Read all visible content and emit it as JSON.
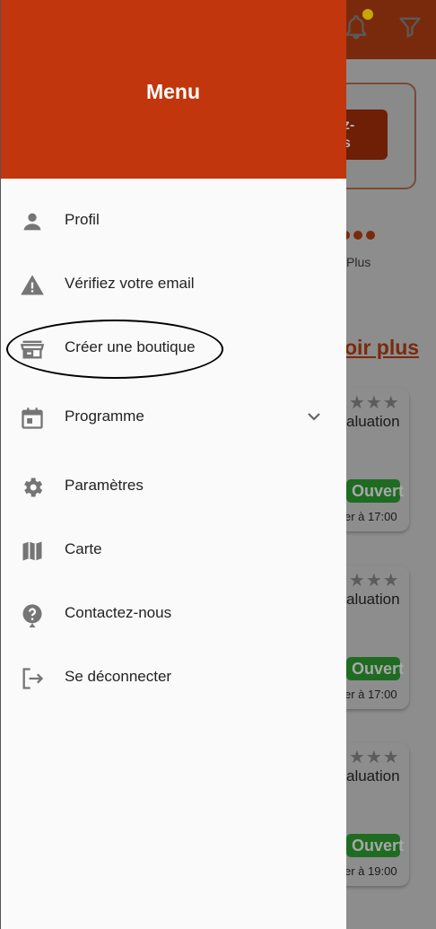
{
  "drawer": {
    "title": "Menu",
    "items": [
      {
        "label": "Profil",
        "icon": "person-icon"
      },
      {
        "label": "Vérifiez votre email",
        "icon": "warning-icon"
      },
      {
        "label": "Créer une boutique",
        "icon": "store-icon"
      },
      {
        "label": "Programme",
        "icon": "calendar-icon"
      },
      {
        "label": "Paramètres",
        "icon": "gear-icon"
      },
      {
        "label": "Carte",
        "icon": "map-icon"
      },
      {
        "label": "Contactez-nous",
        "icon": "help-icon"
      },
      {
        "label": "Se déconnecter",
        "icon": "logout-icon"
      }
    ]
  },
  "background": {
    "button_fragment": "z-\ns",
    "plus_text": "Plus",
    "voir_plus": "oir plus",
    "cards": [
      {
        "eval_text": "aluation",
        "status": "Ouvert",
        "hours": "er à 17:00"
      },
      {
        "eval_text": "aluation",
        "status": "Ouvert",
        "hours": "er à 17:00"
      },
      {
        "eval_text": "aluation",
        "status": "Ouvert",
        "hours": "er à 19:00"
      }
    ]
  },
  "colors": {
    "header_orange": "#c1360d",
    "open_green": "#2e9e33"
  }
}
